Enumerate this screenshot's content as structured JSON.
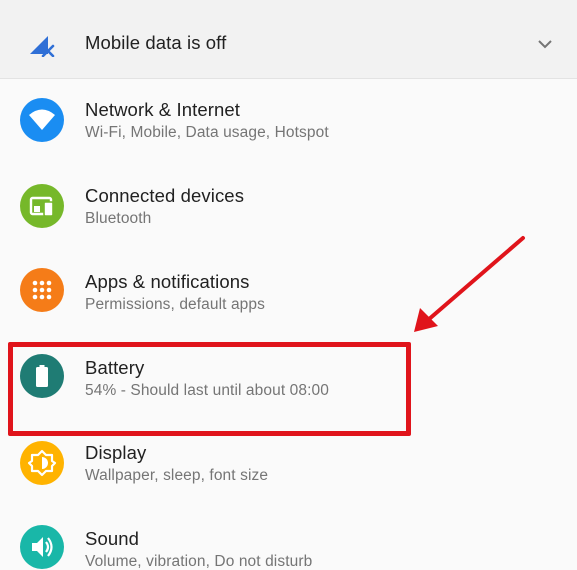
{
  "status": {
    "text": "Mobile data is off",
    "icon": "mobile-data-off-icon"
  },
  "items": [
    {
      "title": "Network & Internet",
      "subtitle": "Wi-Fi, Mobile, Data usage, Hotspot",
      "icon": "wifi-icon",
      "color": "#1a8df2"
    },
    {
      "title": "Connected devices",
      "subtitle": "Bluetooth",
      "icon": "devices-icon",
      "color": "#76b82a"
    },
    {
      "title": "Apps & notifications",
      "subtitle": "Permissions, default apps",
      "icon": "apps-grid-icon",
      "color": "#f57c18"
    },
    {
      "title": "Battery",
      "subtitle": "54% - Should last until about 08:00",
      "icon": "battery-icon",
      "color": "#1f7c74"
    },
    {
      "title": "Display",
      "subtitle": "Wallpaper, sleep, font size",
      "icon": "brightness-icon",
      "color": "#ffb300"
    },
    {
      "title": "Sound",
      "subtitle": "Volume, vibration, Do not disturb",
      "icon": "volume-icon",
      "color": "#19b7a8"
    }
  ],
  "annotation": {
    "color": "#e0141b"
  }
}
